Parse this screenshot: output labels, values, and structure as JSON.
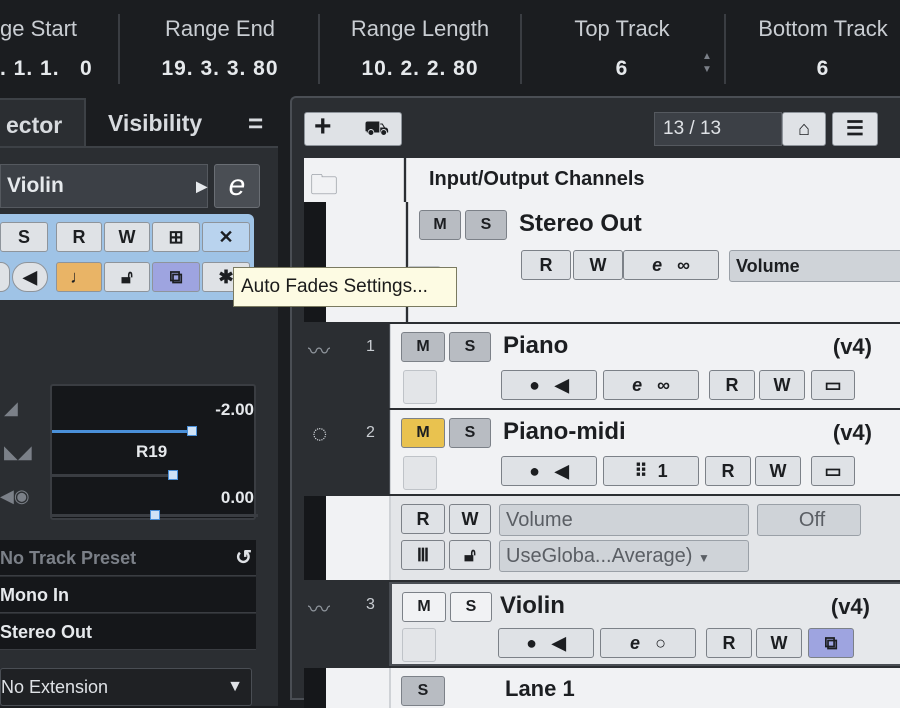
{
  "info_line": {
    "columns": [
      {
        "label": "ge Start",
        "value": ". 1. 1.   0"
      },
      {
        "label": "Range End",
        "value": "19. 3. 3. 80"
      },
      {
        "label": "Range Length",
        "value": "10. 2. 2. 80"
      },
      {
        "label": "Top Track",
        "value": "6"
      },
      {
        "label": "Bottom Track",
        "value": "6"
      }
    ]
  },
  "inspector": {
    "tabs": [
      "ector",
      "Visibility"
    ],
    "menu_icon": "hamburger-icon",
    "track_name": "Violin",
    "edit_label": "e",
    "buttons_row1": [
      "S",
      "R",
      "W"
    ],
    "volume_value": "-2.00",
    "pan_value": "R19",
    "delay_value": "0.00",
    "track_preset": "No Track Preset",
    "input_routing": "Mono In",
    "output_routing": "Stereo Out",
    "extension": "No Extension"
  },
  "tooltip": "Auto Fades Settings...",
  "project": {
    "counter": "13 / 13",
    "folder": {
      "name": "Input/Output Channels"
    },
    "stereo_out": {
      "name": "Stereo Out",
      "m": "M",
      "s": "S",
      "r": "R",
      "w": "W",
      "param": "Volume"
    },
    "tracks": [
      {
        "num": "1",
        "name": "Piano",
        "version": "(v4)"
      },
      {
        "num": "2",
        "name": "Piano-midi",
        "version": "(v4)",
        "channel": "1"
      },
      {
        "num": "3",
        "name": "Violin",
        "version": "(v4)"
      }
    ],
    "automation": {
      "param": "Volume",
      "state": "Off",
      "mode": "UseGloba...Average)"
    },
    "lane": {
      "name": "Lane 1",
      "s": "S"
    }
  },
  "colors": {
    "accent_blue": "#4a90d9",
    "mute_yellow": "#e9c24f",
    "purple": "#9ea4e0",
    "orange": "#e9b466"
  }
}
